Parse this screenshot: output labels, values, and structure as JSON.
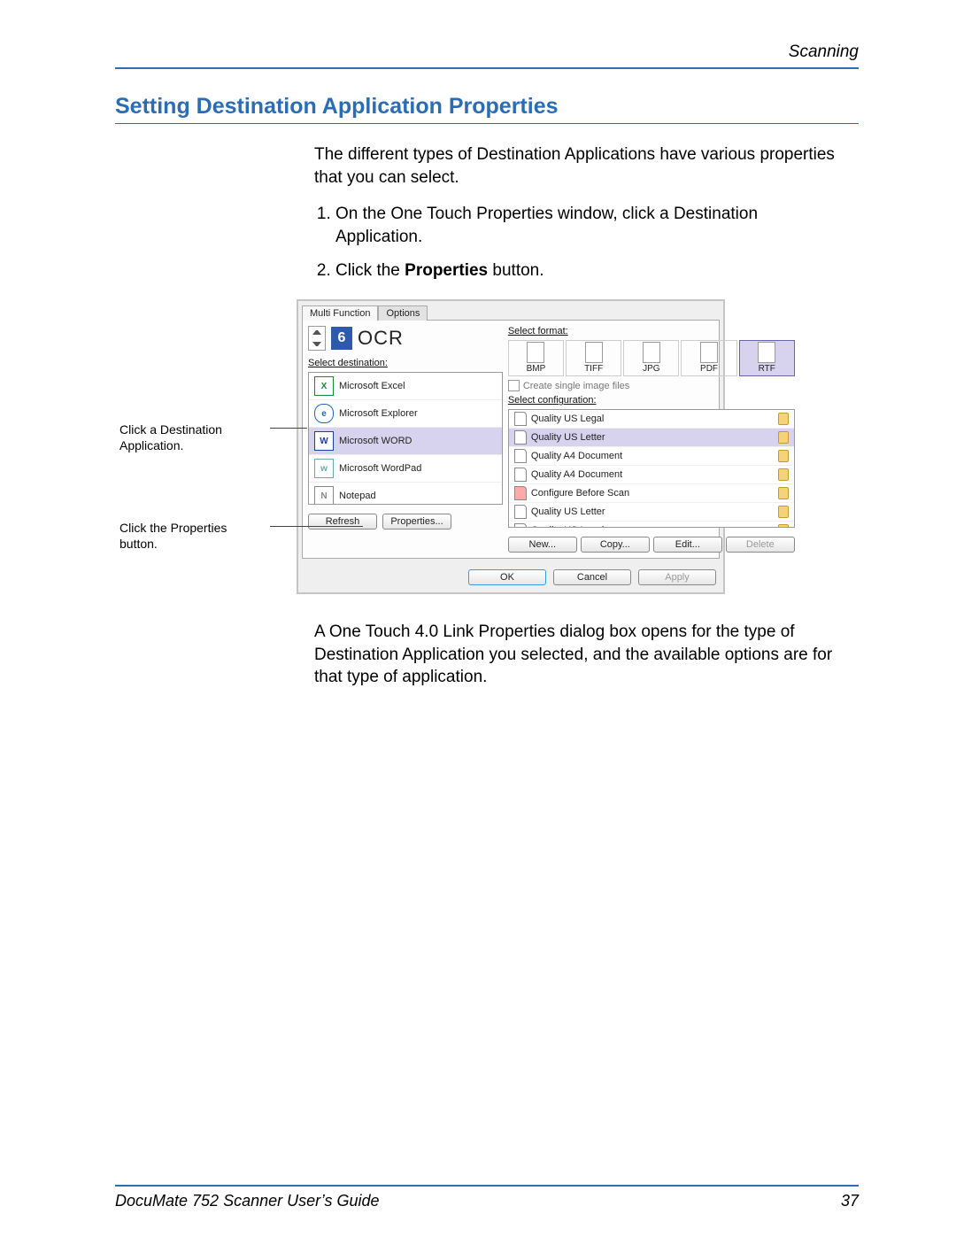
{
  "page_header": {
    "section": "Scanning"
  },
  "heading": "Setting Destination Application Properties",
  "intro": "The different types of Destination Applications have various properties that you can select.",
  "steps": {
    "s1": "On the One Touch Properties window, click a Destination Application.",
    "s2_prefix": "Click the ",
    "s2_bold": "Properties",
    "s2_suffix": " button."
  },
  "callouts": {
    "a": "Click a Destination Application.",
    "b": "Click the Properties button."
  },
  "dialog": {
    "tabs": {
      "active": "Multi Function",
      "inactive": "Options"
    },
    "idx_number": "6",
    "ocr_label": "OCR",
    "select_dest_label": "Select destination:",
    "destinations": [
      {
        "name": "Microsoft Excel",
        "icon": "X"
      },
      {
        "name": "Microsoft Explorer",
        "icon": "e"
      },
      {
        "name": "Microsoft WORD",
        "icon": "W"
      },
      {
        "name": "Microsoft WordPad",
        "icon": "w"
      },
      {
        "name": "Notepad",
        "icon": "N"
      }
    ],
    "selected_destination_index": 2,
    "refresh_btn": "Refresh",
    "properties_btn": "Properties...",
    "select_format_label": "Select format:",
    "formats": [
      "BMP",
      "TIFF",
      "JPG",
      "PDF",
      "RTF"
    ],
    "selected_format_index": 4,
    "single_image_label": "Create single image files",
    "select_config_label": "Select configuration:",
    "configs": [
      "Quality US Legal",
      "Quality US Letter",
      "Quality A4 Document",
      "Quality A4 Document",
      "Configure Before Scan",
      "Quality US Letter",
      "Quality US Legal"
    ],
    "selected_config_index": 1,
    "cfg_buttons": {
      "new": "New...",
      "copy": "Copy...",
      "edit": "Edit...",
      "delete": "Delete"
    },
    "bottom": {
      "ok": "OK",
      "cancel": "Cancel",
      "apply": "Apply"
    }
  },
  "after_para": "A One Touch 4.0 Link Properties dialog box opens for the type of Destination Application you selected, and the available options are for that type of application.",
  "footer": {
    "left": "DocuMate 752 Scanner User’s Guide",
    "right": "37"
  }
}
